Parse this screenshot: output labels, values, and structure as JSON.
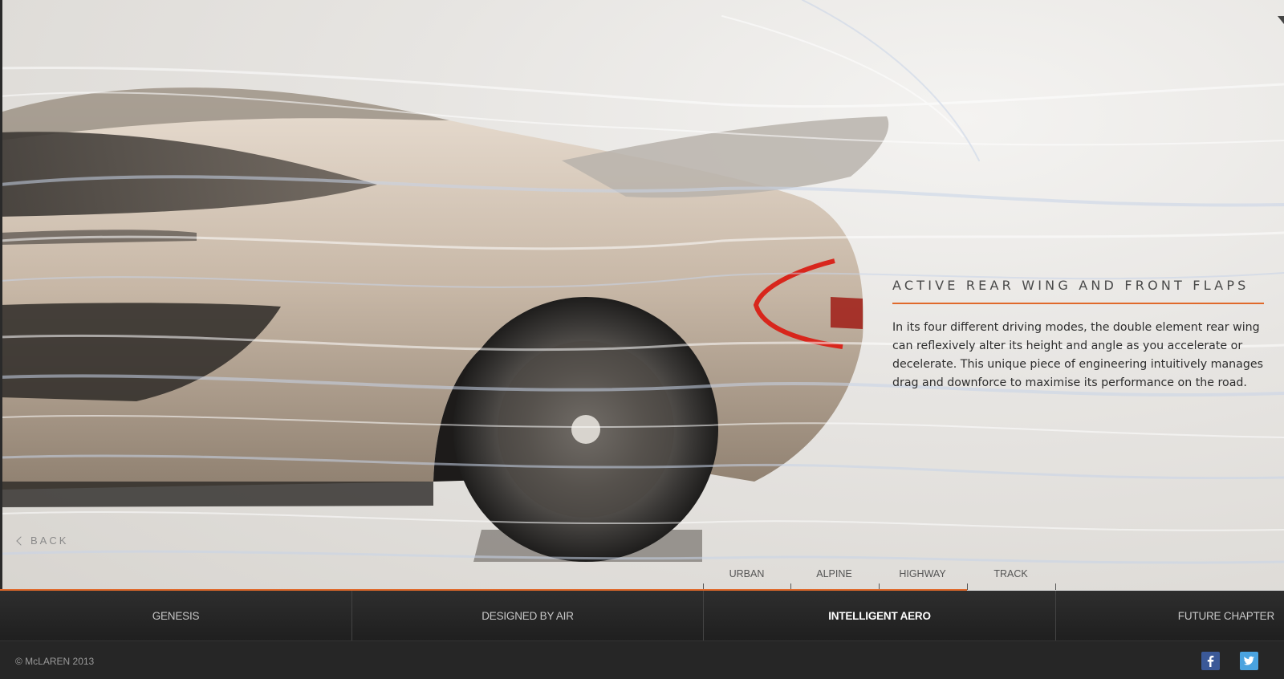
{
  "feature": {
    "title": "ACTIVE REAR WING AND FRONT FLAPS",
    "body": "In its four different driving modes, the double element rear wing can reflexively alter its height and angle as you accelerate or decelerate. This unique piece of engineering intuitively manages drag and downforce to maximise its performance on the road."
  },
  "back_label": "BACK",
  "modes": [
    "URBAN",
    "ALPINE",
    "HIGHWAY",
    "TRACK"
  ],
  "nav": {
    "items": [
      "GENESIS",
      "DESIGNED BY AIR",
      "INTELLIGENT AERO",
      "FUTURE CHAPTER"
    ],
    "active": "INTELLIGENT AERO"
  },
  "footer": {
    "copyright": "© McLAREN 2013",
    "social": [
      "facebook-icon",
      "twitter-icon"
    ]
  },
  "colors": {
    "accent": "#e0692a",
    "nav_bg": "#262626",
    "facebook": "#3b5998",
    "twitter": "#4aa3df"
  }
}
